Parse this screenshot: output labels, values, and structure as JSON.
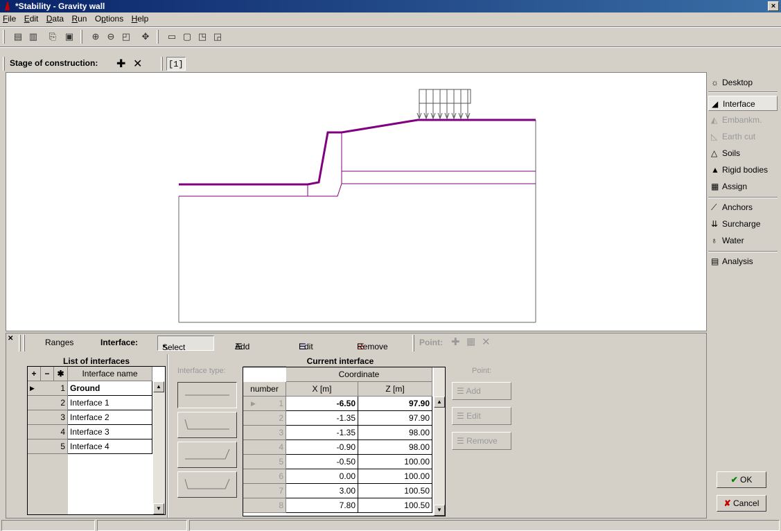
{
  "window": {
    "title": "*Stability - Gravity wall",
    "close_label": "×"
  },
  "menu": [
    {
      "label": "File",
      "u": "F"
    },
    {
      "label": "Edit",
      "u": "E"
    },
    {
      "label": "Data",
      "u": "D"
    },
    {
      "label": "Run",
      "u": "R"
    },
    {
      "label": "Options",
      "u": "p"
    },
    {
      "label": "Help",
      "u": "H"
    }
  ],
  "stage": {
    "label": "Stage of construction:",
    "tab": "[1]"
  },
  "right_panel": {
    "items": [
      {
        "label": "Desktop",
        "icon": "desktop-icon",
        "state": "normal"
      },
      {
        "label": "Interface",
        "icon": "interface-icon",
        "state": "active"
      },
      {
        "label": "Embankm.",
        "icon": "embankment-icon",
        "state": "disabled"
      },
      {
        "label": "Earth cut",
        "icon": "earth-cut-icon",
        "state": "disabled"
      },
      {
        "label": "Soils",
        "icon": "soils-icon",
        "state": "normal"
      },
      {
        "label": "Rigid bodies",
        "icon": "rigid-bodies-icon",
        "state": "normal"
      },
      {
        "label": "Assign",
        "icon": "assign-icon",
        "state": "normal"
      },
      {
        "label": "Anchors",
        "icon": "anchors-icon",
        "state": "normal"
      },
      {
        "label": "Surcharge",
        "icon": "surcharge-icon",
        "state": "normal"
      },
      {
        "label": "Water",
        "icon": "water-icon",
        "state": "normal"
      },
      {
        "label": "Analysis",
        "icon": "analysis-icon",
        "state": "normal"
      }
    ],
    "ok_label": "OK",
    "cancel_label": "Cancel"
  },
  "bottom_toolbar": {
    "ranges": "Ranges",
    "interface_label": "Interface:",
    "select": "Select",
    "add": "Add",
    "edit": "Edit",
    "remove": "Remove",
    "point_label": "Point:"
  },
  "interfaces": {
    "title": "List of interfaces",
    "column": "Interface name",
    "rows": [
      {
        "n": "1",
        "name": "Ground"
      },
      {
        "n": "2",
        "name": "Interface 1"
      },
      {
        "n": "3",
        "name": "Interface 2"
      },
      {
        "n": "4",
        "name": "Interface 3"
      },
      {
        "n": "5",
        "name": "Interface 4"
      }
    ]
  },
  "interface_type_label": "Interface type:",
  "current": {
    "title": "Current interface",
    "col_number": "number",
    "col_coordinate": "Coordinate",
    "col_x": "X [m]",
    "col_z": "Z [m]",
    "rows": [
      {
        "n": "1",
        "x": "-6.50",
        "z": "97.90"
      },
      {
        "n": "2",
        "x": "-1.35",
        "z": "97.90"
      },
      {
        "n": "3",
        "x": "-1.35",
        "z": "98.00"
      },
      {
        "n": "4",
        "x": "-0.90",
        "z": "98.00"
      },
      {
        "n": "5",
        "x": "-0.50",
        "z": "100.00"
      },
      {
        "n": "6",
        "x": "0.00",
        "z": "100.00"
      },
      {
        "n": "7",
        "x": "3.00",
        "z": "100.50"
      },
      {
        "n": "8",
        "x": "7.80",
        "z": "100.50"
      }
    ]
  },
  "point_panel": {
    "title": "Point:",
    "add": "Add",
    "edit": "Edit",
    "remove": "Remove"
  }
}
